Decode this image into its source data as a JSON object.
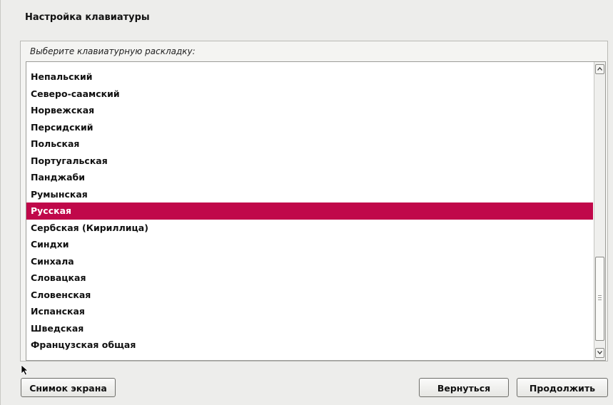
{
  "dialog": {
    "title": "Настройка клавиатуры",
    "prompt": "Выберите клавиатурную раскладку:"
  },
  "layouts": {
    "items": [
      "Непальский",
      "Северо-саамский",
      "Норвежская",
      "Персидский",
      "Польская",
      "Португальская",
      "Панджаби",
      "Румынская",
      "Русская",
      "Сербская (Кириллица)",
      "Синдхи",
      "Синхала",
      "Словацкая",
      "Словенская",
      "Испанская",
      "Шведская",
      "Французская общая"
    ],
    "selected": "Русская"
  },
  "buttons": {
    "screenshot": "Снимок экрана",
    "back": "Вернуться",
    "continue": "Продолжить"
  },
  "colors": {
    "selection": "#c0084a"
  },
  "icons": {
    "scroll_up": "chevron-up-icon",
    "scroll_down": "chevron-down-icon",
    "cursor": "mouse-pointer-icon"
  }
}
